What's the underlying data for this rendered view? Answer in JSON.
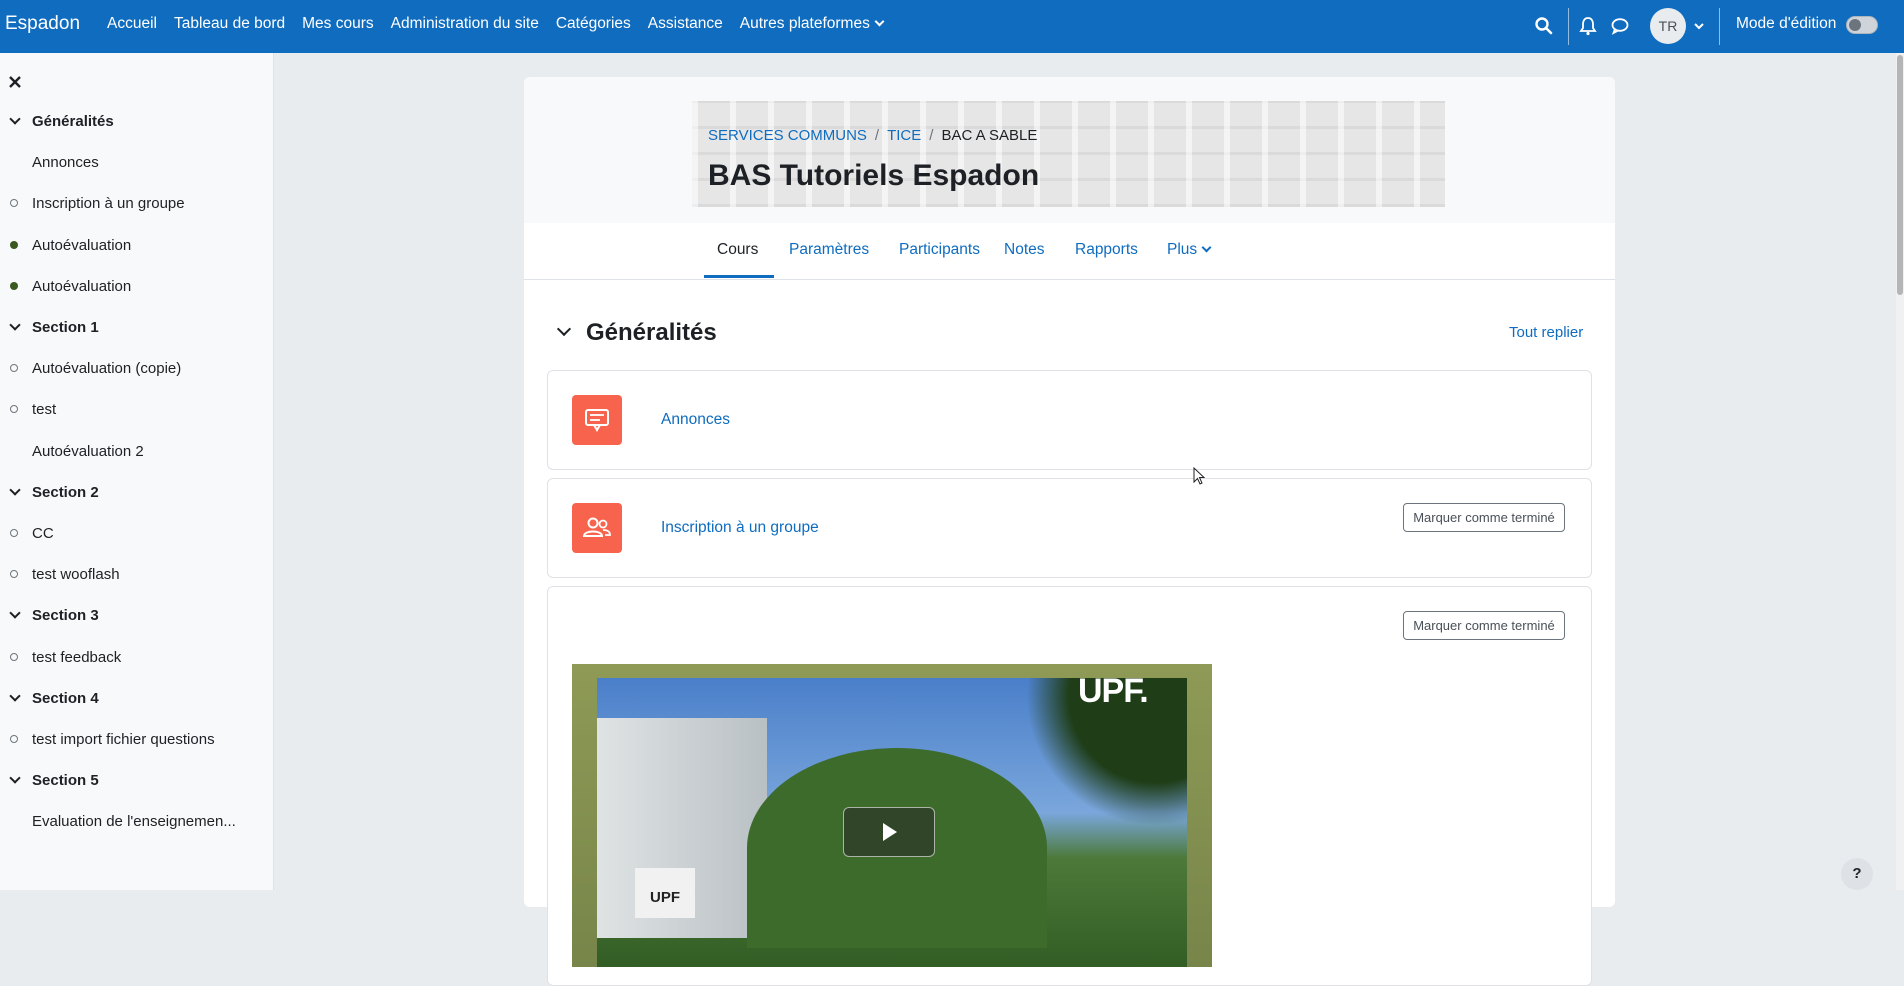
{
  "app": {
    "brand": "Espadon"
  },
  "topnav": {
    "items": [
      "Accueil",
      "Tableau de bord",
      "Mes cours",
      "Administration du site",
      "Catégories",
      "Assistance",
      "Autres plateformes"
    ],
    "avatar_initials": "TR",
    "edit_mode_label": "Mode d'édition",
    "edit_mode_on": false
  },
  "drawer": {
    "items": [
      {
        "type": "section",
        "label": "Généralités"
      },
      {
        "type": "activity",
        "label": "Annonces",
        "status": "none"
      },
      {
        "type": "activity",
        "label": "Inscription à un groupe",
        "status": "empty"
      },
      {
        "type": "activity",
        "label": "Autoévaluation",
        "status": "done"
      },
      {
        "type": "activity",
        "label": "Autoévaluation",
        "status": "done"
      },
      {
        "type": "section",
        "label": "Section 1"
      },
      {
        "type": "activity",
        "label": "Autoévaluation (copie)",
        "status": "empty"
      },
      {
        "type": "activity",
        "label": "test",
        "status": "empty"
      },
      {
        "type": "activity",
        "label": "Autoévaluation 2",
        "status": "none"
      },
      {
        "type": "section",
        "label": "Section 2"
      },
      {
        "type": "activity",
        "label": "CC",
        "status": "empty"
      },
      {
        "type": "activity",
        "label": "test wooflash",
        "status": "empty"
      },
      {
        "type": "section",
        "label": "Section 3"
      },
      {
        "type": "activity",
        "label": "test feedback",
        "status": "empty"
      },
      {
        "type": "section",
        "label": "Section 4"
      },
      {
        "type": "activity",
        "label": "test import fichier questions",
        "status": "empty"
      },
      {
        "type": "section",
        "label": "Section 5"
      },
      {
        "type": "activity",
        "label": "Evaluation de l'enseignemen...",
        "status": "none"
      }
    ]
  },
  "course": {
    "breadcrumb": [
      "SERVICES COMMUNS",
      "TICE",
      "BAC A SABLE"
    ],
    "title": "BAS Tutoriels Espadon",
    "tabs": [
      "Cours",
      "Paramètres",
      "Participants",
      "Notes",
      "Rapports",
      "Plus"
    ],
    "active_tab": "Cours"
  },
  "section": {
    "title": "Généralités",
    "collapse_all": "Tout replier",
    "activities": [
      {
        "label": "Annonces",
        "icon": "forum-icon"
      },
      {
        "label": "Inscription à un groupe",
        "icon": "group-icon",
        "button": "Marquer comme terminé"
      },
      {
        "label": "",
        "icon": "video",
        "button": "Marquer comme terminé"
      }
    ]
  },
  "video": {
    "logo": "UPF.",
    "sign": "UPF"
  },
  "help": {
    "label": "?"
  },
  "colors": {
    "primary": "#0f6cbf",
    "activity_icon": "#f7634d",
    "done_marker": "#3a5a1f"
  }
}
